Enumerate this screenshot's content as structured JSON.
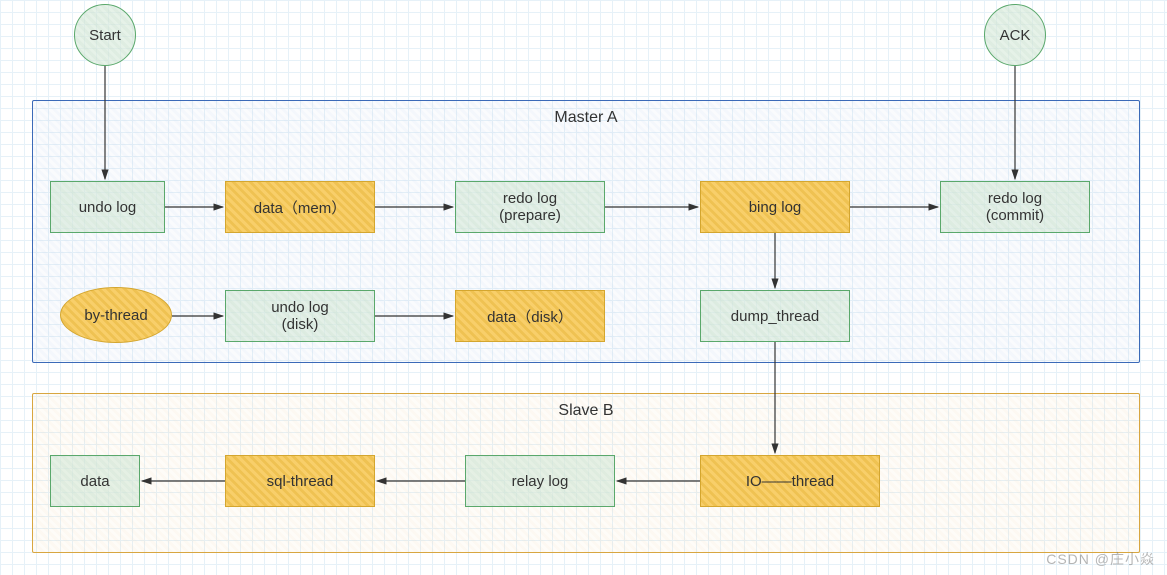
{
  "start": "Start",
  "ack": "ACK",
  "master": {
    "title": "Master A",
    "undo_log": "undo log",
    "data_mem": "data（mem）",
    "redo_prepare": "redo log\n(prepare)",
    "bing_log": "bing log",
    "redo_commit": "redo log\n(commit)",
    "by_thread": "by-thread",
    "undo_disk": "undo log\n(disk)",
    "data_disk": "data（disk）",
    "dump_thread": "dump_thread"
  },
  "slave": {
    "title": "Slave B",
    "io_thread": "IO——thread",
    "relay_log": "relay log",
    "sql_thread": "sql-thread",
    "data": "data"
  },
  "watermark": "CSDN @庄小焱"
}
